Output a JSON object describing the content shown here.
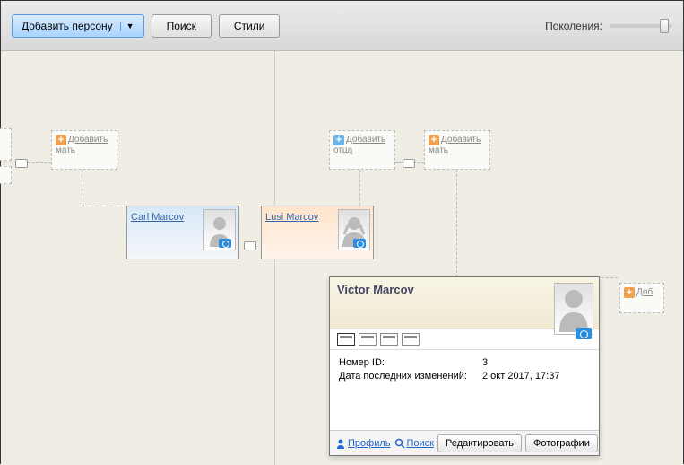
{
  "toolbar": {
    "add_person": "Добавить персону",
    "search": "Поиск",
    "styles": "Стили",
    "generations": "Поколения:"
  },
  "placeholders": {
    "add_mother": "Добавить мать",
    "add_father": "Добавить отца",
    "add_short": "Доб"
  },
  "cards": {
    "carl": "Carl Marcov",
    "lusi": "Lusi Marcov"
  },
  "popup": {
    "name": "Victor Marcov",
    "id_label": "Номер ID:",
    "id_value": "3",
    "date_label": "Дата последних изменений:",
    "date_value": "2 окт 2017, 17:37",
    "profile": "Профиль",
    "search": "Поиск",
    "edit": "Редактировать",
    "photos": "Фотографии"
  }
}
